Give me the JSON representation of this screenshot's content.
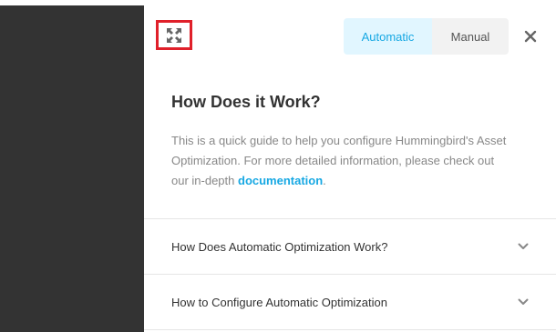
{
  "header": {
    "collapse_icon": "collapse-arrows-icon",
    "mode_toggle": {
      "options": [
        "Automatic",
        "Manual"
      ],
      "selected": "Automatic"
    },
    "close_icon": "close-icon",
    "highlight_color": "#e0202a",
    "accent_color": "#17a8e3"
  },
  "content": {
    "title": "How Does it Work?",
    "description_text": "This is a quick guide to help you configure Hummingbird's Asset Optimization. For more detailed information, please check out our in-depth ",
    "link_text": "documentation",
    "description_end": "."
  },
  "accordion": {
    "items": [
      {
        "label": "How Does Automatic Optimization Work?",
        "icon": "chevron-down-icon"
      },
      {
        "label": "How to Configure Automatic Optimization",
        "icon": "chevron-down-icon"
      }
    ]
  }
}
